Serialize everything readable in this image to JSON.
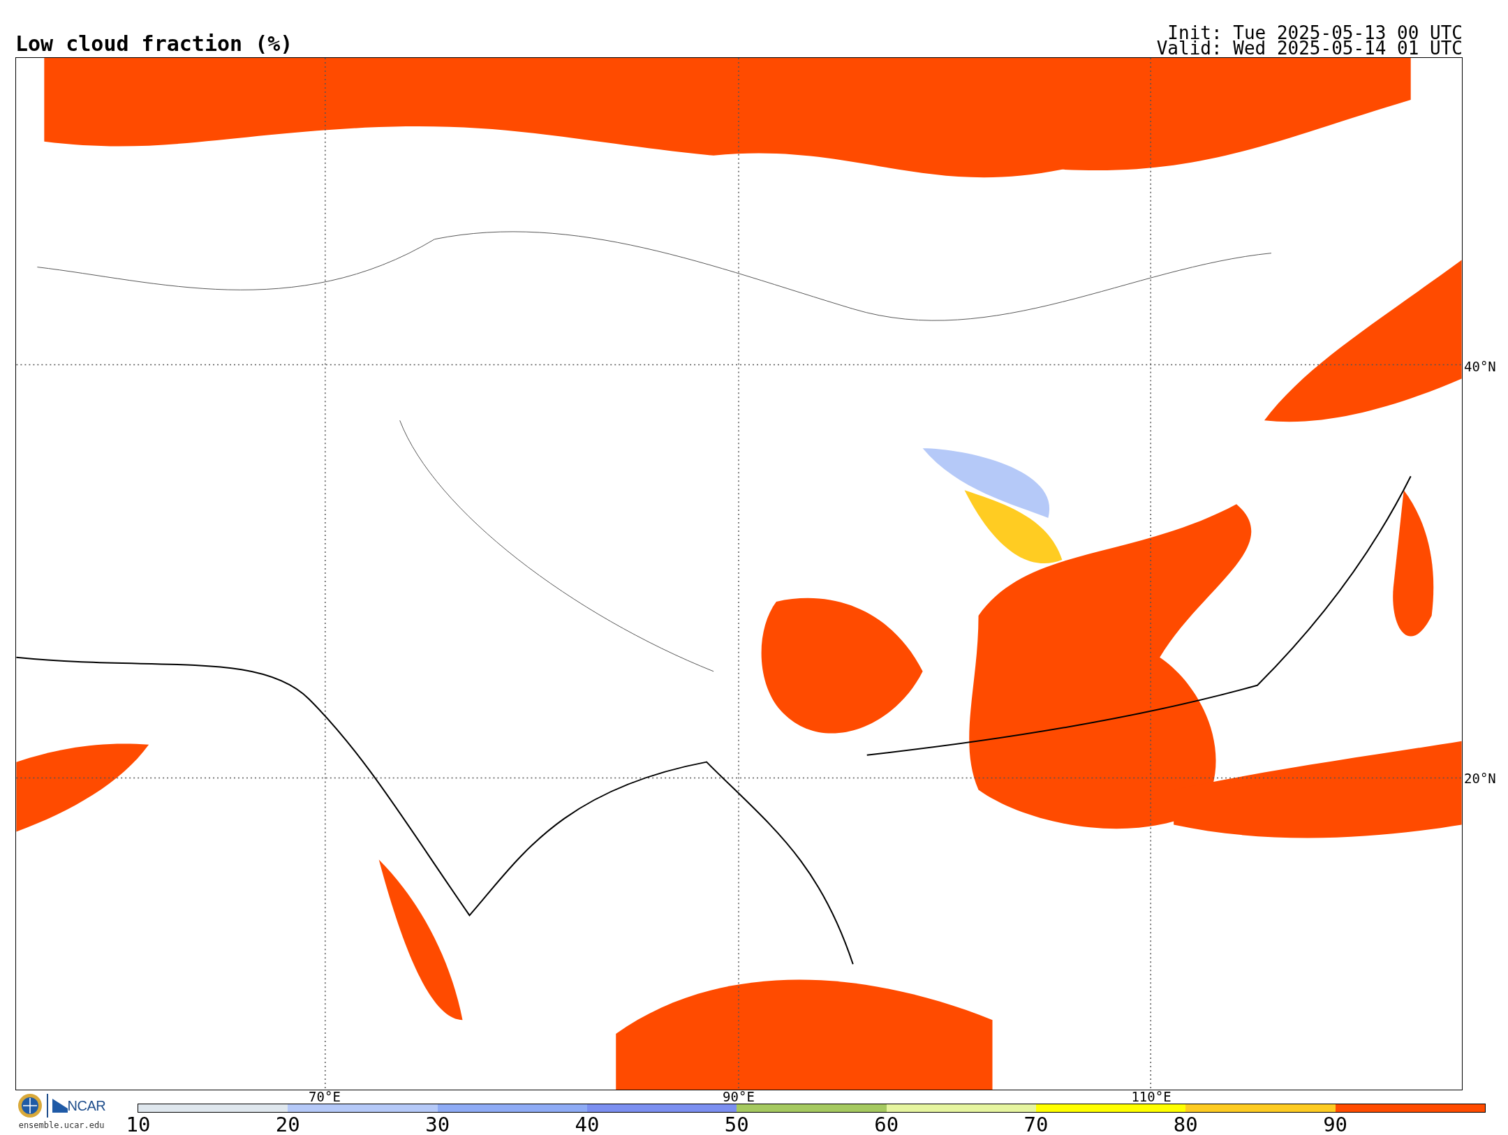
{
  "title": "Low cloud fraction (%)",
  "run_info": [
    "Init: Tue 2025-05-13 00 UTC",
    "Valid: Wed 2025-05-14 01 UTC"
  ],
  "map": {
    "lat_labels": [
      "40°N",
      "20°N"
    ],
    "lon_labels": [
      "70°E",
      "90°E",
      "110°E"
    ]
  },
  "logo": {
    "name": "NCAR",
    "url": "ensemble.ucar.edu"
  },
  "colorbar": [
    {
      "label": "10",
      "color": "#dfe7ee"
    },
    {
      "label": "20",
      "color": "#b5c9f8"
    },
    {
      "label": "30",
      "color": "#8eabf5"
    },
    {
      "label": "40",
      "color": "#7b8ff0"
    },
    {
      "label": "50",
      "color": "#a5c960"
    },
    {
      "label": "60",
      "color": "#e6f5a0"
    },
    {
      "label": "70",
      "color": "#ffff00"
    },
    {
      "label": "80",
      "color": "#fdcb22"
    },
    {
      "label": "90",
      "color": "#ff4b00"
    }
  ]
}
